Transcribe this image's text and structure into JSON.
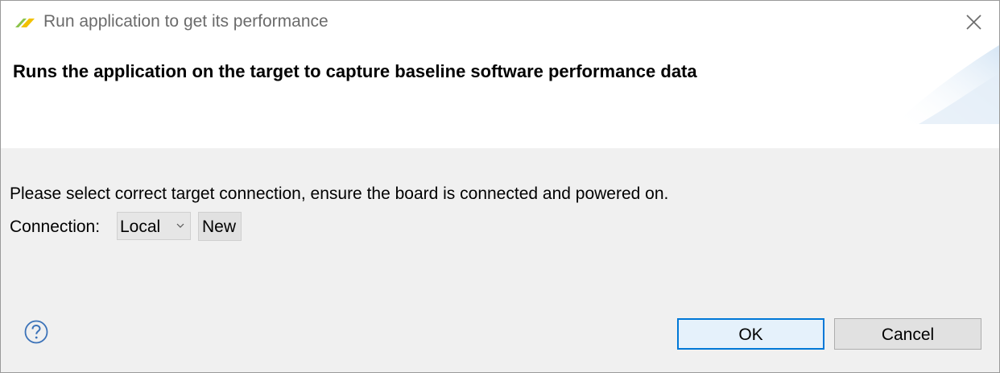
{
  "window": {
    "title": "Run application to get its performance",
    "app_icon": "eclipse-app-icon",
    "close_icon": "close-icon"
  },
  "header": {
    "title": "Runs the application on the target to capture baseline software performance data"
  },
  "content": {
    "instruction": "Please select correct target connection, ensure the board is connected and powered on.",
    "connection_label": "Connection:",
    "connection_selected": "Local",
    "new_button_label": "New"
  },
  "footer": {
    "help_icon": "help-icon",
    "ok_label": "OK",
    "cancel_label": "Cancel"
  },
  "colors": {
    "accent": "#0078d7",
    "icon_green": "#8bc34a",
    "icon_yellow": "#f2c100"
  }
}
